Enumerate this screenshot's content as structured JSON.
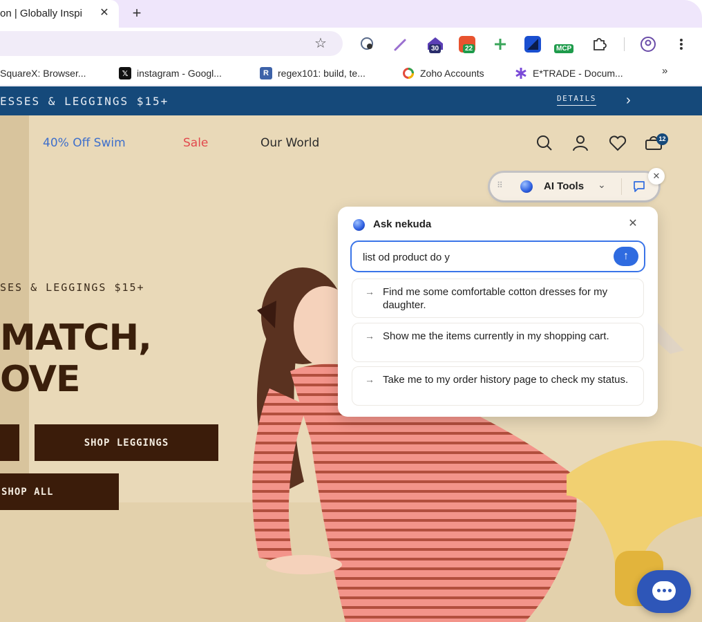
{
  "browser": {
    "tab_title": "on | Globally Inspi",
    "tab_close": "✕",
    "new_tab": "+",
    "bookmarks": [
      {
        "label": "SquareX: Browser...",
        "icon": "squarex-icon"
      },
      {
        "label": "instagram - Googl...",
        "icon": "x-icon",
        "icon_glyph": "𝕏"
      },
      {
        "label": "regex101: build, te...",
        "icon": "regex101-icon",
        "icon_glyph": "R"
      },
      {
        "label": "Zoho Accounts",
        "icon": "zoho-icon"
      },
      {
        "label": "E*TRADE - Docum...",
        "icon": "etrade-icon"
      }
    ],
    "bookmarks_more": "»",
    "extension_badges": {
      "ext_30": "30",
      "ext_22": "22",
      "mcp": "MCP"
    }
  },
  "promo": {
    "text": "ESSES & LEGGINGS $15+",
    "details": "DETAILS",
    "next": "›"
  },
  "nav": {
    "links": [
      "40% Off Swim",
      "Sale",
      "Our World"
    ],
    "link_colors": [
      "#3e6fcb",
      "#e2494d",
      "#2b2b2b"
    ],
    "cart_count": "12"
  },
  "hero": {
    "eyebrow": "SES & LEGGINGS $15+",
    "headline_1": "MATCH,",
    "headline_2": "OVE",
    "shop_leggings": "SHOP LEGGINGS",
    "shop_all": "SHOP ALL"
  },
  "ai_tools": {
    "label": "AI Tools",
    "chevron": "⌄",
    "close": "✕",
    "grip": "⠿"
  },
  "nekuda": {
    "title": "Ask nekuda",
    "close": "✕",
    "input_value": "list od product do y",
    "send": "↑",
    "suggestions": [
      "Find me some comfortable cotton dresses for my daughter.",
      "Show me the items currently in my shopping cart.",
      "Take me to my order history page to check my status."
    ],
    "arrow": "→"
  },
  "colors": {
    "promo_bg": "#15497a",
    "button_bg": "#3b1c0a",
    "accent_blue": "#2f6be0",
    "hero_bg": "#e9d9b8"
  }
}
